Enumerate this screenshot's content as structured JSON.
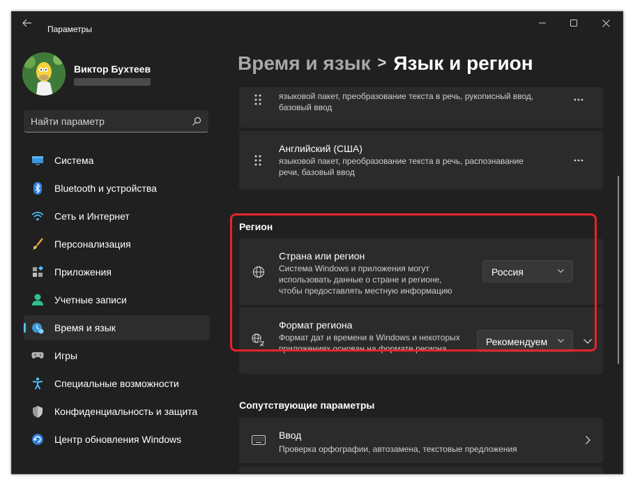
{
  "window": {
    "app_title": "Параметры"
  },
  "profile": {
    "name": "Виктор Бухтеев"
  },
  "search": {
    "placeholder": "Найти параметр"
  },
  "nav": {
    "items": [
      {
        "label": "Система",
        "icon": "system-icon"
      },
      {
        "label": "Bluetooth и устройства",
        "icon": "bluetooth-icon"
      },
      {
        "label": "Сеть и Интернет",
        "icon": "wifi-icon"
      },
      {
        "label": "Персонализация",
        "icon": "brush-icon"
      },
      {
        "label": "Приложения",
        "icon": "apps-icon"
      },
      {
        "label": "Учетные записи",
        "icon": "account-icon"
      },
      {
        "label": "Время и язык",
        "icon": "time-language-icon",
        "active": true
      },
      {
        "label": "Игры",
        "icon": "gamepad-icon"
      },
      {
        "label": "Специальные возможности",
        "icon": "accessibility-icon"
      },
      {
        "label": "Конфиденциальность и защита",
        "icon": "shield-icon"
      },
      {
        "label": "Центр обновления Windows",
        "icon": "update-icon"
      }
    ]
  },
  "breadcrumb": {
    "parent": "Время и язык",
    "separator": ">",
    "current": "Язык и регион"
  },
  "languages": [
    {
      "title": "",
      "desc": "языковой пакет, преобразование текста в речь, рукописный ввод, базовый ввод"
    },
    {
      "title": "Английский (США)",
      "desc": "языковой пакет, преобразование текста в речь, распознавание речи, базовый ввод"
    }
  ],
  "region": {
    "section_title": "Регион",
    "country": {
      "title": "Страна или регион",
      "desc": "Система Windows и приложения могут использовать данные о стране и регионе, чтобы предоставлять местную информацию",
      "value": "Россия"
    },
    "format": {
      "title": "Формат региона",
      "desc": "Формат дат и времени в Windows и некоторых приложениях основан на формате региона.",
      "value": "Рекомендуем"
    }
  },
  "related": {
    "section_title": "Сопутствующие параметры",
    "input": {
      "title": "Ввод",
      "desc": "Проверка орфографии, автозамена, текстовые предложения"
    }
  },
  "colors": {
    "accent": "#4cc2ff",
    "highlight": "#e8232b",
    "background": "#202020",
    "card": "#2b2b2b"
  }
}
